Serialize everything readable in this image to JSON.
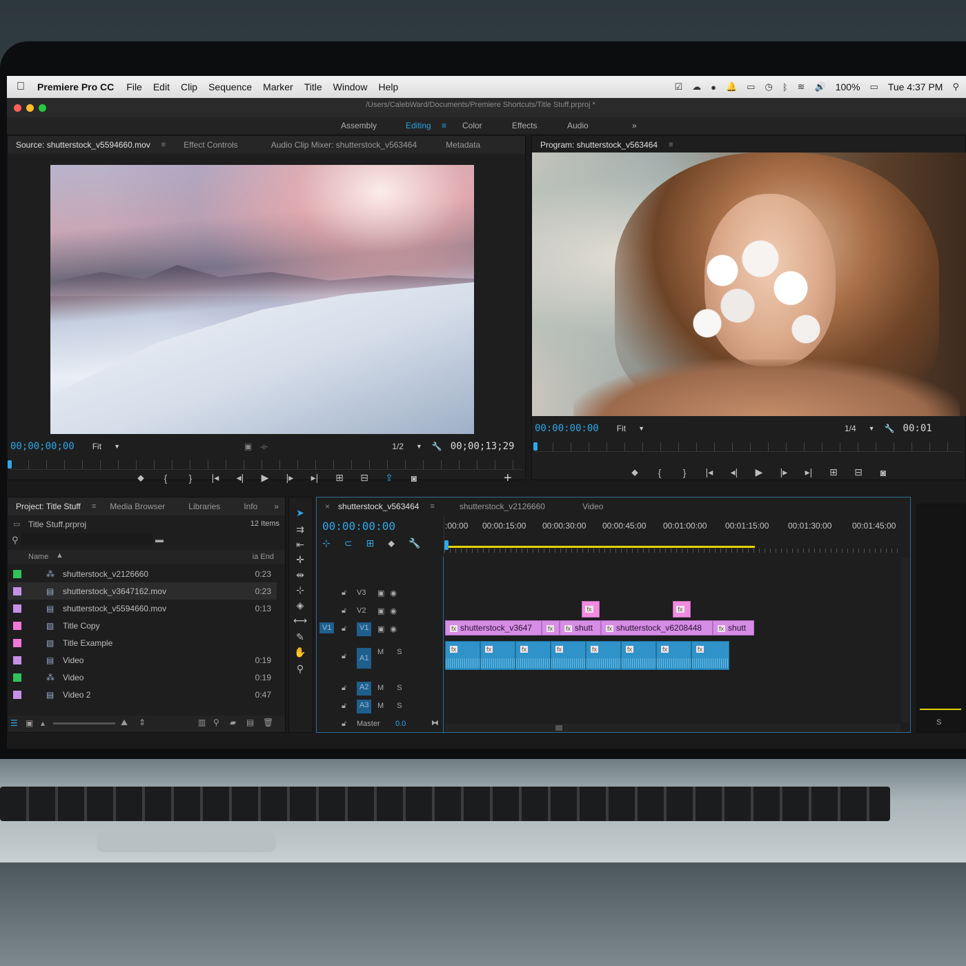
{
  "menubar": {
    "app_name": "Premiere Pro CC",
    "items": [
      "File",
      "Edit",
      "Clip",
      "Sequence",
      "Marker",
      "Title",
      "Window",
      "Help"
    ],
    "battery": "100%",
    "clock": "Tue 4:37 PM"
  },
  "window": {
    "path": "/Users/CalebWard/Documents/Premiere Shortcuts/Title Stuff.prproj *",
    "traffic_colors": [
      "#fc5f57",
      "#fdbc2e",
      "#28c840"
    ]
  },
  "workspaces": {
    "items": [
      "Assembly",
      "Editing",
      "Color",
      "Effects",
      "Audio"
    ],
    "active": "Editing",
    "more": "»"
  },
  "source_monitor": {
    "tabs": [
      "Source: shutterstock_v5594660.mov",
      "Effect Controls",
      "Audio Clip Mixer: shutterstock_v563464",
      "Metadata"
    ],
    "timecode": "00;00;00;00",
    "zoom": "Fit",
    "resolution": "1/2",
    "duration": "00;00;13;29"
  },
  "program_monitor": {
    "tab": "Program: shutterstock_v563464",
    "timecode": "00:00:00:00",
    "zoom": "Fit",
    "resolution": "1/4",
    "duration": "00:01"
  },
  "transport_glyphs": [
    "⬥",
    "{",
    "}",
    "|◂",
    "◂|",
    "▶",
    "|▸",
    "▸|",
    "⊞",
    "⊟",
    "⇪",
    "◙"
  ],
  "add_button": "+",
  "project": {
    "tabs": [
      "Project: Title Stuff",
      "Media Browser",
      "Libraries",
      "Info"
    ],
    "more": "»",
    "file": "Title Stuff.prproj",
    "count": "12 Items",
    "col_name": "Name",
    "col_end": "ia End",
    "rows": [
      {
        "color": "#2fc45a",
        "name": "shutterstock_v2126660",
        "end": "0:23",
        "icon": "sequence"
      },
      {
        "color": "#c690e8",
        "name": "shutterstock_v3647162.mov",
        "end": "0:23",
        "icon": "clip"
      },
      {
        "color": "#c690e8",
        "name": "shutterstock_v5594660.mov",
        "end": "0:13",
        "icon": "clip"
      },
      {
        "color": "#f078d8",
        "name": "Title Copy",
        "end": "",
        "icon": "title"
      },
      {
        "color": "#f078d8",
        "name": "Title Example",
        "end": "",
        "icon": "title"
      },
      {
        "color": "#c690e8",
        "name": "Video",
        "end": "0:19",
        "icon": "clip"
      },
      {
        "color": "#2fc45a",
        "name": "Video",
        "end": "0:19",
        "icon": "sequence"
      },
      {
        "color": "#c690e8",
        "name": "Video 2",
        "end": "0:47",
        "icon": "clip"
      }
    ]
  },
  "timeline": {
    "tabs": [
      "shutterstock_v563464",
      "shutterstock_v2126660",
      "Video"
    ],
    "timecode": "00:00:00:00",
    "ticks": [
      ":00:00",
      "00:00:15:00",
      "00:00:30:00",
      "00:00:45:00",
      "00:01:00:00",
      "00:01:15:00",
      "00:01:30:00",
      "00:01:45:00"
    ],
    "tracks": {
      "v3": "V3",
      "v2": "V2",
      "v1": "V1",
      "v1_src": "V1",
      "a1": "A1",
      "a2": "A2",
      "a3": "A3",
      "master": "Master",
      "master_val": "0.0",
      "ms": "M  S"
    },
    "video_clips": [
      "shutterstock_v3647",
      "shutt",
      "shutterstock_v6208448",
      "shutt"
    ],
    "fx": "fx",
    "side_label": "S"
  },
  "colors": {
    "accent": "#2ea7ea",
    "video_clip": "#d58de6",
    "audio_clip": "#2f93c9",
    "title_clip": "#f08be0",
    "work_area": "#e3d300"
  }
}
